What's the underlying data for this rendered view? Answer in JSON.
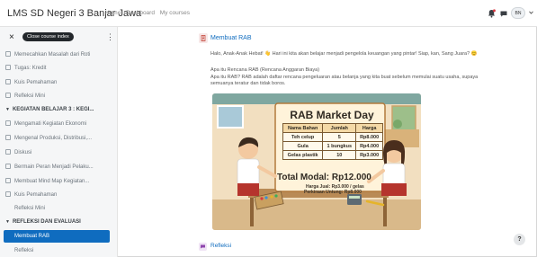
{
  "header": {
    "site_name": "LMS SD Negeri 3 Banjar Jawa",
    "nav_links": [
      "Home",
      "Dashboard",
      "My courses"
    ],
    "user_initials": "BN"
  },
  "drawer": {
    "close_label": "Close course index",
    "items": [
      {
        "type": "item",
        "label": "Memecahkan Masalah dari Roti"
      },
      {
        "type": "item",
        "label": "Tugas: Kredit"
      },
      {
        "type": "item",
        "label": "Kuis Pemahaman"
      },
      {
        "type": "item",
        "label": "Refleksi Mini"
      },
      {
        "type": "section",
        "label": "KEGIATAN BELAJAR 3 : KEGI..."
      },
      {
        "type": "item",
        "label": "Mengamati Kegiatan Ekonomi"
      },
      {
        "type": "item",
        "label": "Mengenal Produksi, Distribusi,..."
      },
      {
        "type": "item",
        "label": "Diskusi"
      },
      {
        "type": "item",
        "label": "Bermain Peran Menjadi Pelaku..."
      },
      {
        "type": "item",
        "label": "Membuat Mind Map Kegiatan..."
      },
      {
        "type": "item",
        "label": "Kuis Pemahaman"
      },
      {
        "type": "plain",
        "label": "Refleksi Mini"
      },
      {
        "type": "section",
        "label": "REFLEKSI DAN EVALUASI"
      }
    ],
    "active_item": "Membuat RAB",
    "trailing_item": "Refleksi"
  },
  "main": {
    "activity_title": "Membuat RAB",
    "intro": "Halo, Anak-Anak Hebat! 👋 Hari ini kita akan belajar menjadi pengelola keuangan yang pintar! Siap, kan, Sang Juara? 😊",
    "description_title": "Apa itu Rencana RAB (Rencana Anggaran Biaya)",
    "description": "Apa itu RAB? RAB adalah daftar rencana pengeluaran atau belanja yang kita buat sebelum memulai suatu usaha, supaya semuanya teratur dan tidak boros.",
    "next_activity": "Refleksi"
  },
  "illustration": {
    "title": "RAB Market Day",
    "table_headers": [
      "Nama Bahan",
      "Jumlah",
      "Harga"
    ],
    "table_rows": [
      [
        "Teh celup",
        "5",
        "Rp8.000"
      ],
      [
        "Gula",
        "1 bungkus",
        "Rp4.000"
      ],
      [
        "Gelas plastik",
        "10",
        "Rp3.000"
      ]
    ],
    "total": "Total Modal: Rp12.000",
    "note_price": "Harga Jual: Rp3.000 / gelas",
    "note_profit": "Perkiraan Untung: Rp8.000"
  },
  "help_label": "?",
  "colors": {
    "accent": "#0f6cbf",
    "sidebar_bg": "#f5f6f7",
    "illustration_bg": "#f2dfc0"
  }
}
